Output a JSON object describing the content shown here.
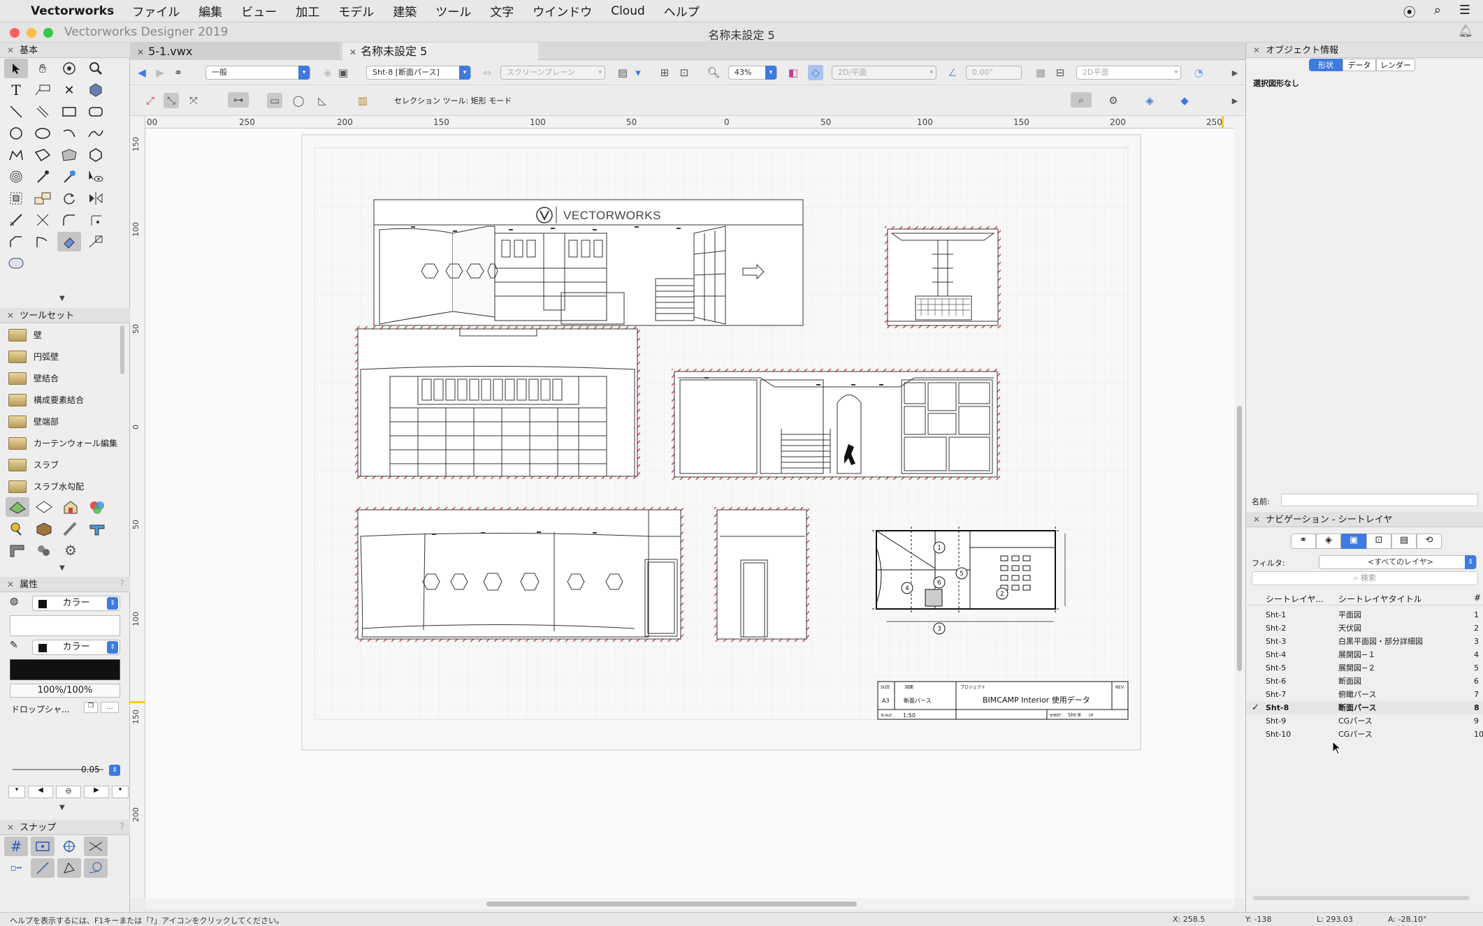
{
  "menubar": {
    "app_name": "Vectorworks",
    "items": [
      "ファイル",
      "編集",
      "ビュー",
      "加工",
      "モデル",
      "建築",
      "ツール",
      "文字",
      "ウインドウ",
      "Cloud",
      "ヘルプ"
    ]
  },
  "window": {
    "app_title": "Vectorworks Designer 2019",
    "doc_title": "名称未設定 5"
  },
  "tabs": [
    {
      "label": "5-1.vwx"
    },
    {
      "label": "名称未設定 5"
    }
  ],
  "left_panel": {
    "basic_title": "基本",
    "toolset_title": "ツールセット",
    "toolset_items": [
      "壁",
      "円弧壁",
      "壁結合",
      "構成要素結合",
      "壁端部",
      "カーテンウォール編集",
      "スラブ",
      "スラブ水勾配"
    ],
    "attributes_title": "属性",
    "fill_label": "カラー",
    "pen_label": "カラー",
    "opacity": "100%/100%",
    "drop_shadow_label": "ドロップシャ...",
    "line_weight": "0.05",
    "snap_title": "スナップ"
  },
  "toolbar": {
    "class_dropdown": "一般",
    "layer_dropdown": "Sht-8 [断面パース]",
    "plane_dropdown": "スクリーンプレーン",
    "zoom": "43%",
    "view_dropdown": "2D/平面",
    "angle": "0.00°",
    "render_dropdown": "2D平面",
    "mode_text": "セレクション ツール: 矩形 モード"
  },
  "rulers": {
    "h_ticks": [
      "00",
      "250",
      "200",
      "150",
      "100",
      "50",
      "0",
      "50",
      "100",
      "150",
      "200",
      "250"
    ],
    "v_ticks": [
      "150",
      "100",
      "50",
      "0",
      "50",
      "100",
      "150",
      "200"
    ]
  },
  "drawing": {
    "logo_text": "VECTORWORKS",
    "title_block": {
      "size_label": "SIZE",
      "size_value": "A3",
      "drawing_label": "図面",
      "drawing_value": "断面パース",
      "project_label": "プロジェクト",
      "project_value": "BIMCAMP Interior 使用データ",
      "rev_label": "REV",
      "scale_label": "SCALE",
      "scale_value": "1:50",
      "sheet_label": "SHEET",
      "sheet_value": "Sht-8",
      "of_label": "OF"
    },
    "floor_plan_markers": [
      "1",
      "2",
      "3",
      "4",
      "5",
      "6"
    ]
  },
  "right_panel": {
    "obj_info_title": "オブジェクト情報",
    "obj_tabs": [
      "形状",
      "データ",
      "レンダー"
    ],
    "no_selection": "選択図形なし",
    "name_label": "名前:",
    "nav_title": "ナビゲーション - シートレイヤ",
    "filter_label": "フィルタ:",
    "filter_value": "<すべてのレイヤ>",
    "search_placeholder": "検索",
    "col_sheet": "シートレイヤ...",
    "col_title": "シートレイヤタイトル",
    "col_num": "#",
    "rows": [
      {
        "id": "Sht-1",
        "title": "平面図",
        "num": "1"
      },
      {
        "id": "Sht-2",
        "title": "天伏図",
        "num": "2"
      },
      {
        "id": "Sht-3",
        "title": "白黒平面図・部分詳細図",
        "num": "3"
      },
      {
        "id": "Sht-4",
        "title": "展開図−１",
        "num": "4"
      },
      {
        "id": "Sht-5",
        "title": "展開図−２",
        "num": "5"
      },
      {
        "id": "Sht-6",
        "title": "断面図",
        "num": "6"
      },
      {
        "id": "Sht-7",
        "title": "俯瞰パース",
        "num": "7"
      },
      {
        "id": "Sht-8",
        "title": "断面パース",
        "num": "8"
      },
      {
        "id": "Sht-9",
        "title": "CGパース",
        "num": "9"
      },
      {
        "id": "Sht-10",
        "title": "CGパース",
        "num": "10"
      }
    ],
    "active_row": "Sht-8"
  },
  "status": {
    "help": "ヘルプを表示するには、F1キーまたは「?」アイコンをクリックしてください。",
    "x": "X: 258.5",
    "y": "Y: -138",
    "l": "L: 293.03",
    "a": "A: -28.10°"
  }
}
